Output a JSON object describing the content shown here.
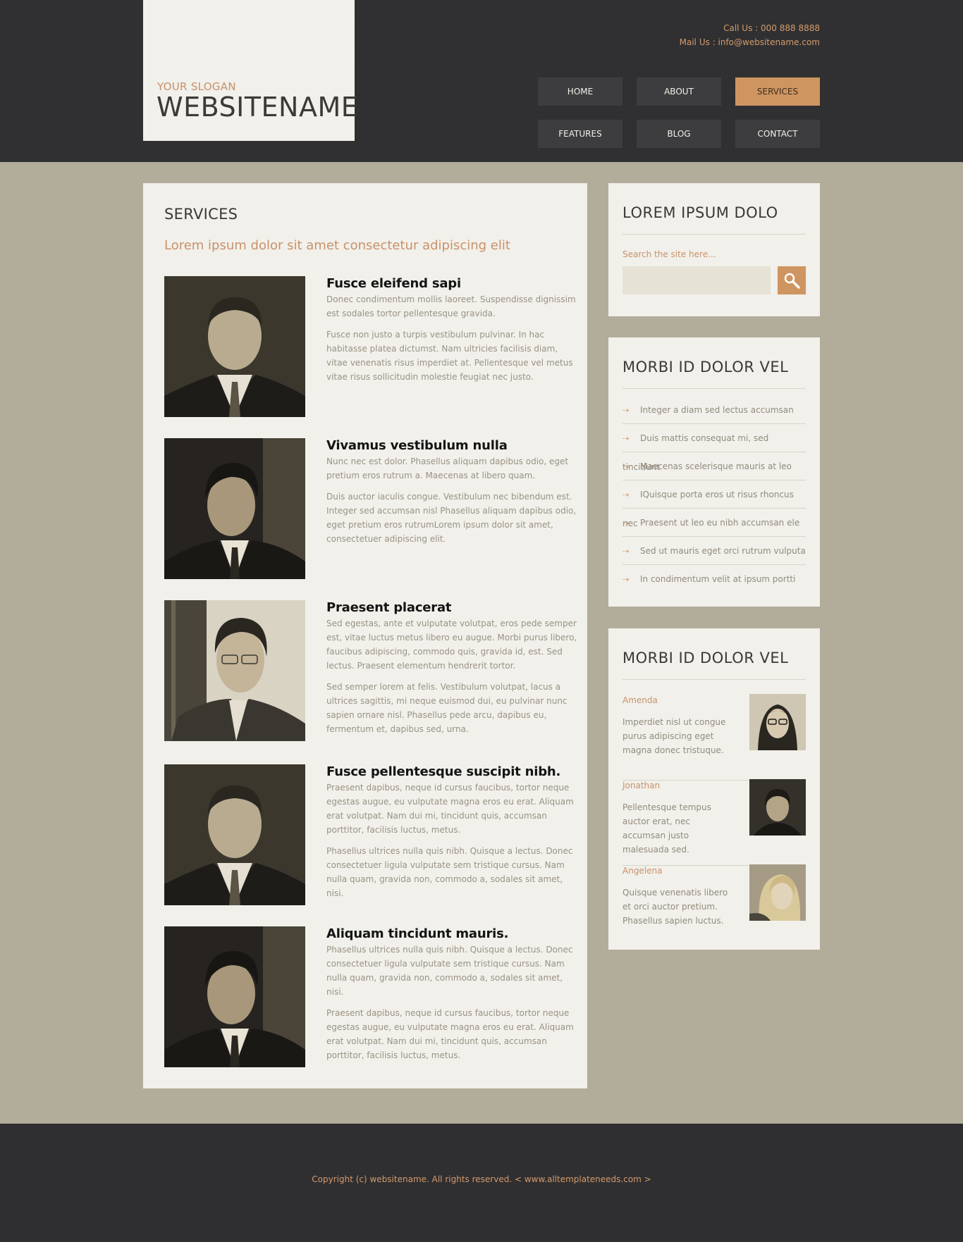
{
  "header": {
    "slogan": "YOUR SLOGAN",
    "sitename": "WEBSITENAME",
    "call_us": "Call Us : 000 888 8888",
    "mail_us": "Mail Us : info@websitename.com"
  },
  "nav": {
    "items": [
      "HOME",
      "ABOUT",
      "SERVICES",
      "FEATURES",
      "BLOG",
      "CONTACT"
    ],
    "active": "SERVICES"
  },
  "main": {
    "title": "SERVICES",
    "subtitle": "Lorem ipsum dolor sit amet consectetur adipiscing elit",
    "services": [
      {
        "title": "Fusce eleifend sapi",
        "p1": "Donec condimentum mollis laoreet. Suspendisse dignissim est sodales tortor pellentesque gravida.",
        "p2": "Fusce non justo a turpis vestibulum pulvinar. In hac habitasse platea dictumst. Nam ultricies facilisis diam, vitae venenatis risus imperdiet at. Pellentesque vel metus vitae risus sollicitudin molestie feugiat nec justo."
      },
      {
        "title": "Vivamus vestibulum nulla",
        "p1": "Nunc nec est dolor. Phasellus aliquam dapibus odio, eget pretium eros rutrum a. Maecenas at libero quam.",
        "p2": "Duis auctor iaculis congue. Vestibulum nec bibendum est. Integer sed accumsan nisl Phasellus aliquam dapibus odio, eget pretium eros rutrumLorem ipsum dolor sit amet, consectetuer adipiscing elit."
      },
      {
        "title": "Praesent placerat",
        "p1": "Sed egestas, ante et vulputate volutpat, eros pede semper est, vitae luctus metus libero eu augue. Morbi purus libero, faucibus adipiscing, commodo quis, gravida id, est. Sed lectus. Praesent elementum hendrerit tortor.",
        "p2": "Sed semper lorem at felis. Vestibulum volutpat, lacus a ultrices sagittis, mi neque euismod dui, eu pulvinar nunc sapien ornare nisl. Phasellus pede arcu, dapibus eu, fermentum et, dapibus sed, urna."
      },
      {
        "title": "Fusce pellentesque suscipit nibh.",
        "p1": "Praesent dapibus, neque id cursus faucibus, tortor neque egestas augue, eu vulputate magna eros eu erat. Aliquam erat volutpat. Nam dui mi, tincidunt quis, accumsan porttitor, facilisis luctus, metus.",
        "p2": "Phasellus ultrices nulla quis nibh. Quisque a lectus. Donec consectetuer ligula vulputate sem tristique cursus. Nam nulla quam, gravida non, commodo a, sodales sit amet, nisi."
      },
      {
        "title": "Aliquam tincidunt mauris.",
        "p1": "Phasellus ultrices nulla quis nibh. Quisque a lectus. Donec consectetuer ligula vulputate sem tristique cursus. Nam nulla quam, gravida non, commodo a, sodales sit amet, nisi.",
        "p2": "Praesent dapibus, neque id cursus faucibus, tortor neque egestas augue, eu vulputate magna eros eu erat. Aliquam erat volutpat. Nam dui mi, tincidunt quis, accumsan porttitor, facilisis luctus, metus."
      }
    ]
  },
  "sidebar": {
    "search": {
      "title": "LOREM IPSUM DOLO",
      "label": "Search the site here...",
      "value": ""
    },
    "links": {
      "title": "MORBI ID DOLOR VEL",
      "items": [
        "Integer a diam sed lectus accumsan",
        "Duis mattis consequat mi, sed tincidunt",
        "Maecenas scelerisque mauris at leo",
        "IQuisque porta eros ut risus rhoncus nec",
        "Praesent ut leo eu nibh accumsan ele",
        "Sed ut mauris eget orci rutrum vulputa",
        "In condimentum velit at ipsum portti"
      ]
    },
    "testimonials": {
      "title": "MORBI ID DOLOR VEL",
      "items": [
        {
          "name": "Amenda",
          "text": "Imperdiet nisl ut congue purus adipiscing eget magna donec tristuque."
        },
        {
          "name": "Jonathan",
          "text": "Pellentesque tempus auctor erat, nec accumsan justo malesuada sed."
        },
        {
          "name": "Angelena",
          "text": "Quisque venenatis libero et orci auctor pretium. Phasellus sapien luctus."
        }
      ]
    }
  },
  "footer": {
    "copyright": "Copyright (c) websitename. All rights reserved. < www.alltemplateneeds.com >"
  },
  "colors": {
    "accent": "#cf9560",
    "dark_bg": "#2f2f31",
    "body_bg": "#b2ac9a",
    "panel_bg": "#f1f0ea"
  }
}
